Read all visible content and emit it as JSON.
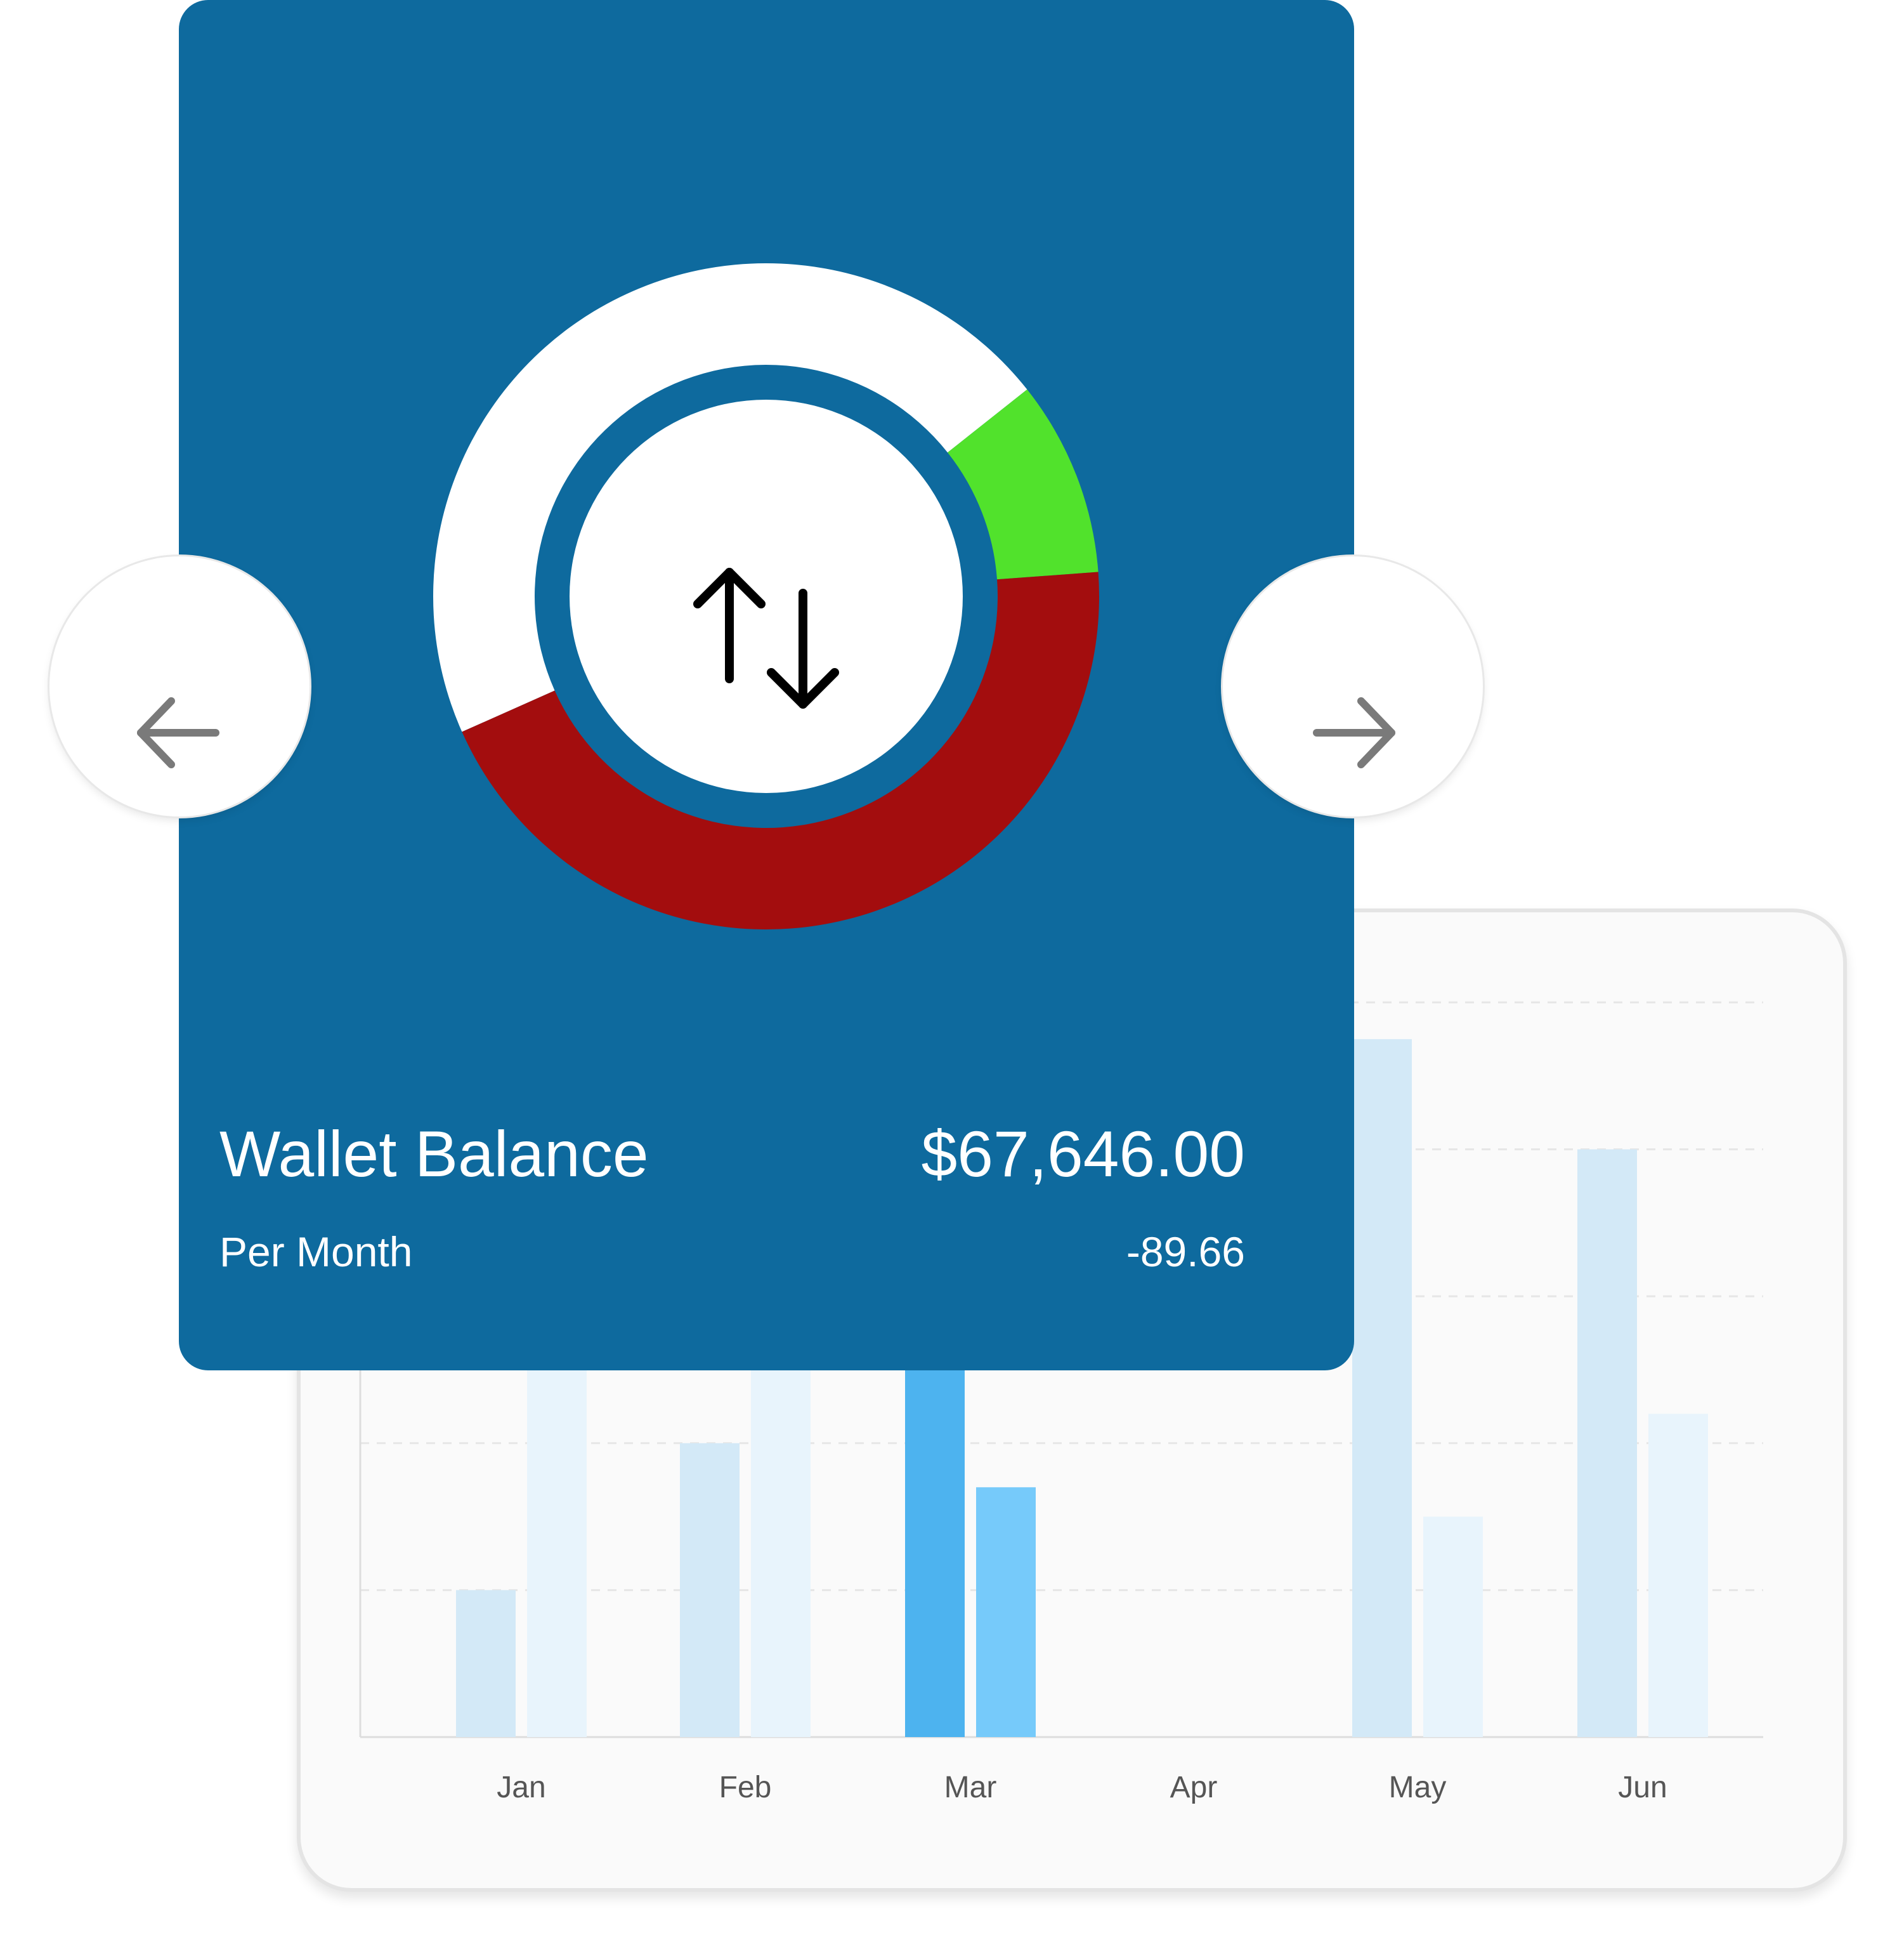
{
  "wallet": {
    "title": "Wallet Balance",
    "amount": "$67,646.00",
    "period": "Per Month",
    "change": "-89.66",
    "background_color": "#0e6a9e",
    "center_icon": "swap-vertical-icon"
  },
  "donut": {
    "segments": [
      {
        "name": "white",
        "color": "#ffffff",
        "fraction": 0.46
      },
      {
        "name": "green",
        "color": "#51e22c",
        "fraction": 0.095
      },
      {
        "name": "red",
        "color": "#a30d0e",
        "fraction": 0.445
      }
    ]
  },
  "navigation": {
    "prev_icon": "arrow-left-icon",
    "next_icon": "arrow-right-icon"
  },
  "chart_data": {
    "type": "bar",
    "categories": [
      "Jan",
      "Feb",
      "Mar",
      "Apr",
      "May",
      "Jun"
    ],
    "series": [
      {
        "values": [
          2.0,
          4.0,
          6.6,
          0,
          9.5,
          8.0
        ],
        "color": "#d3e9f7",
        "highlight_color": "#4db3ef"
      },
      {
        "values": [
          5.4,
          5.4,
          3.4,
          0,
          3.0,
          4.4
        ],
        "color": "#e8f4fc",
        "highlight_color": "#76cafa"
      }
    ],
    "highlighted_category": "Mar",
    "ylim": [
      0,
      10
    ],
    "grid": true,
    "xlabel": "",
    "ylabel": ""
  }
}
